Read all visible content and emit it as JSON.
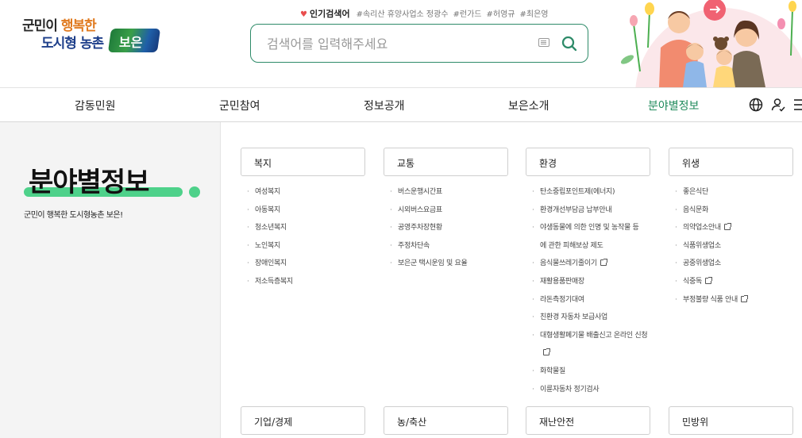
{
  "logo": {
    "line1_prefix": "군민이 ",
    "line1_accent": "행복한",
    "line2": "도시형 농촌",
    "brand": "보은"
  },
  "popular": {
    "title": "인기검색어",
    "keywords": [
      "#속리산 휴양사업소 정광수",
      "#런가드",
      "#허영규",
      "#최은영"
    ]
  },
  "search": {
    "placeholder": "검색어를 입력해주세요"
  },
  "nav": {
    "items": [
      {
        "label": "감동민원"
      },
      {
        "label": "군민참여"
      },
      {
        "label": "정보공개"
      },
      {
        "label": "보은소개"
      },
      {
        "label": "분야별정보"
      }
    ],
    "active_color": "#1f8a5b"
  },
  "page": {
    "title": "분야별정보",
    "subtitle": "군민이 행복한 도시형농촌 보은!",
    "accent_color": "#4ed18a"
  },
  "categories": [
    {
      "name": "복지",
      "items": [
        "여성복지",
        "아동복지",
        "청소년복지",
        "노인복지",
        "장애인복지",
        "저소득층복지"
      ]
    },
    {
      "name": "교통",
      "items": [
        "버스운행시간표",
        "시외버스요금표",
        "공영주차장현황",
        "주정차단속",
        "보은군 택시운임 및 요율"
      ]
    },
    {
      "name": "환경",
      "items": [
        "탄소중립포인트제(에너지)",
        "환경개선부담금 납부안내",
        "야생동물에 의한 인명 및 농작물 등에 관한 피해보상 제도",
        "음식물쓰레기줄이기",
        "재활용품판매장",
        "라돈측정기대여",
        "친환경 자동차 보급사업",
        "대형생활폐기물 배출신고 온라인 신청",
        "화학물질",
        "이륜자동차 정기검사"
      ]
    },
    {
      "name": "위생",
      "items": [
        "좋은식단",
        "음식문화",
        "의약업소안내",
        "식품위생업소",
        "공중위생업소",
        "식중독",
        "부정불량 식품 안내"
      ]
    },
    {
      "name": "기업/경제",
      "items": []
    },
    {
      "name": "농/축산",
      "items": []
    },
    {
      "name": "재난안전",
      "items": []
    },
    {
      "name": "민방위",
      "items": []
    }
  ]
}
